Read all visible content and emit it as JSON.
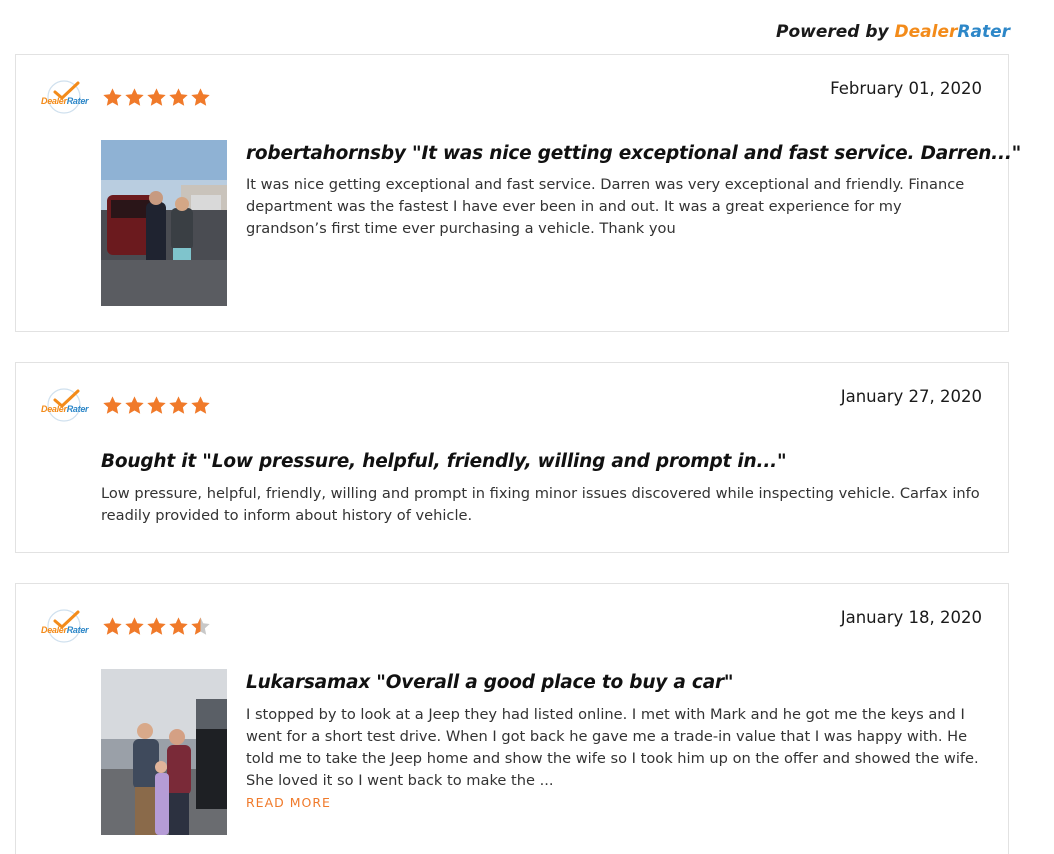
{
  "powered_by": {
    "prefix": "Powered by",
    "brand_dealer": "Dealer",
    "brand_rater": "Rater"
  },
  "logo": {
    "dealer": "Dealer",
    "rater": "Rater"
  },
  "colors": {
    "star": "#f07a2a",
    "star_empty": "#c8c8c8",
    "brand_orange": "#f38b1a",
    "brand_blue": "#2d87c8"
  },
  "reviews": [
    {
      "rating": 5,
      "date": "February 01, 2020",
      "title": "robertahornsby \"It was nice getting exceptional and fast service. Darren...\"",
      "body": "It was nice getting exceptional and fast service. Darren was very exceptional and friendly. Finance department was the fastest I have ever been in and out. It was a great experience for my grandson’s first time ever purchasing a vehicle. Thank you",
      "has_photo": true
    },
    {
      "rating": 5,
      "date": "January 27, 2020",
      "title": "Bought it \"Low pressure, helpful, friendly, willing and prompt in...\"",
      "body": "Low pressure, helpful, friendly, willing and prompt in fixing minor issues discovered while inspecting vehicle. Carfax info readily provided to inform about history of vehicle.",
      "has_photo": false
    },
    {
      "rating": 4.5,
      "date": "January 18, 2020",
      "title": "Lukarsamax \"Overall a good place to buy a car\"",
      "body": "I stopped by to look at a Jeep they had listed online. I met with Mark and he got me the keys and I went for a short test drive. When I got back he gave me a trade-in value that I was happy with. He told me to take the Jeep home and show the wife so I took him up on the offer and showed the wife. She loved it so I went back to make the ...",
      "read_more": "READ MORE",
      "has_photo": true
    }
  ]
}
